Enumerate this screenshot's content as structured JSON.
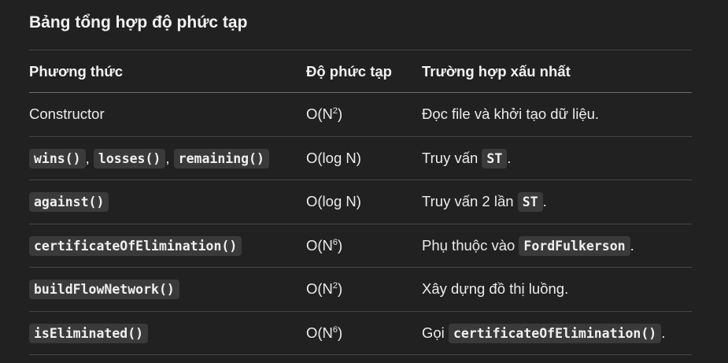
{
  "title": "Bảng tổng hợp độ phức tạp",
  "headers": {
    "method": "Phương thức",
    "complexity": "Độ phức tạp",
    "worst_case": "Trường hợp xấu nhất"
  },
  "rows": [
    {
      "method": "Constructor",
      "complexity_base": "O(N",
      "complexity_exp": "2",
      "complexity_tail": ")",
      "worst_case": "Đọc file và khởi tạo dữ liệu."
    },
    {
      "method_codes": [
        "wins()",
        "losses()",
        "remaining()"
      ],
      "method_sep": ",",
      "complexity": "O(log N)",
      "worst_pre": "Truy vấn ",
      "worst_code": "ST",
      "worst_post": "."
    },
    {
      "method_code": "against()",
      "complexity": "O(log N)",
      "worst_pre": "Truy vấn 2 lần ",
      "worst_code": "ST",
      "worst_post": "."
    },
    {
      "method_code": "certificateOfElimination()",
      "complexity_base": "O(N",
      "complexity_exp": "6",
      "complexity_tail": ")",
      "worst_pre": "Phụ thuộc vào ",
      "worst_code": "FordFulkerson",
      "worst_post": "."
    },
    {
      "method_code": "buildFlowNetwork()",
      "complexity_base": "O(N",
      "complexity_exp": "2",
      "complexity_tail": ")",
      "worst_case": "Xây dựng đồ thị luồng."
    },
    {
      "method_code": "isEliminated()",
      "complexity_base": "O(N",
      "complexity_exp": "6",
      "complexity_tail": ")",
      "worst_pre": "Gọi ",
      "worst_code": "certificateOfElimination()",
      "worst_post": "."
    }
  ]
}
